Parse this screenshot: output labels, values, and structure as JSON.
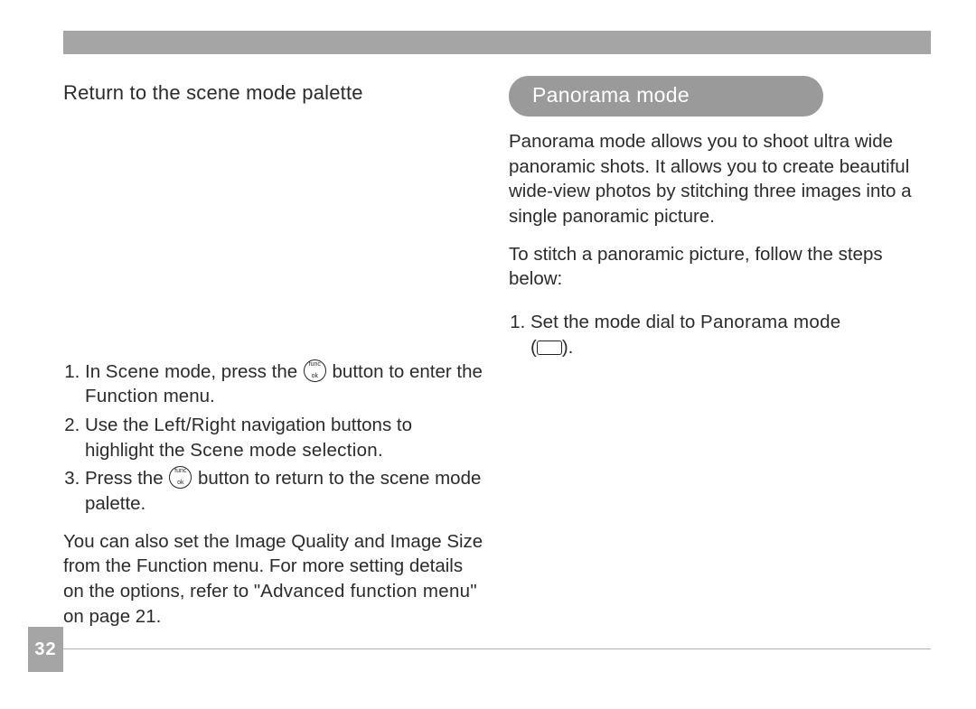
{
  "page_number": "32",
  "left": {
    "heading": "Return to the scene mode palette",
    "step1a": "In ",
    "step1b": "Scene",
    "step1c": " mode, press the ",
    "step1d": " button to enter the ",
    "step1e": "Function",
    "step1f": " menu.",
    "step2a": "Use the ",
    "step2b": "Left/Right",
    "step2c": " navigation buttons to highlight the ",
    "step2d": "Scene mode selection",
    "step2e": ".",
    "step3a": "Press the ",
    "step3b": " button to return to the scene mode palette.",
    "note_a": "You can also set the Image Quality and Image Size from the Function menu. For more setting details on the options, refer to \"",
    "note_b": "Advanced function menu",
    "note_c": "\" on page 21."
  },
  "right": {
    "pill": "Panorama mode",
    "intro": "Panorama mode allows you to shoot ultra wide panoramic shots. It allows you to create beautiful wide-view photos by stitching three images into a single panoramic picture.",
    "instr": "To stitch a panoramic picture, follow the steps below:",
    "step1a": "Set the mode dial to ",
    "step1b": "Panorama mode",
    "step1c": " (",
    "step1d": ")."
  }
}
